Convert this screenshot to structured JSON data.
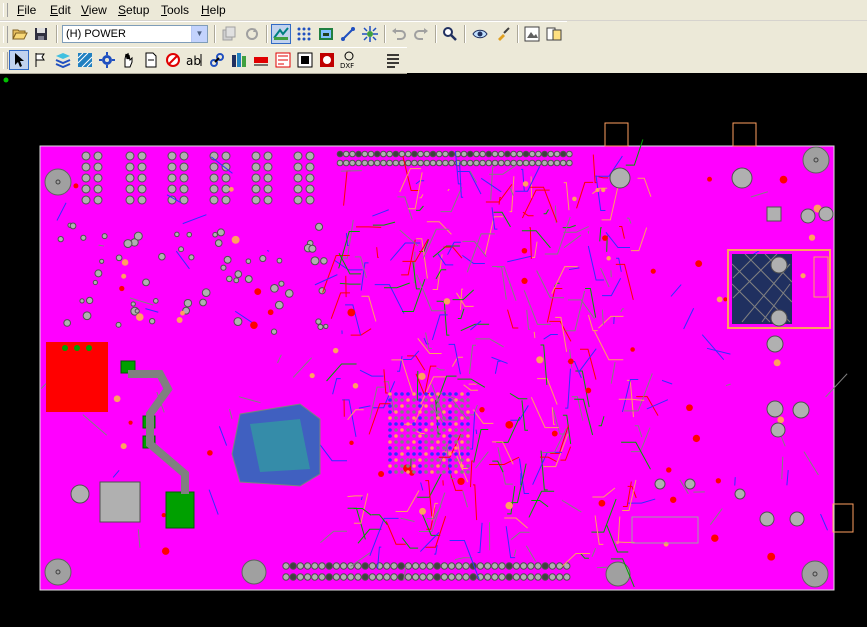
{
  "menubar": {
    "items": [
      {
        "accel": "F",
        "rest": "ile"
      },
      {
        "accel": "E",
        "rest": "dit"
      },
      {
        "accel": "V",
        "rest": "iew"
      },
      {
        "accel": "S",
        "rest": "etup"
      },
      {
        "accel": "T",
        "rest": "ools"
      },
      {
        "accel": "H",
        "rest": "elp"
      }
    ]
  },
  "toolbar": {
    "layer_value": "(H) POWER"
  },
  "icons": {
    "row1": [
      "open-folder-icon",
      "save-icon",
      "copy-icon",
      "refresh-icon",
      "route-icon",
      "grid-icon",
      "camera-icon",
      "add-route-icon",
      "via-icon",
      "undo-icon",
      "redo-icon",
      "zoom-icon",
      "view-icon",
      "paint-icon",
      "snapshot-icon",
      "compare-icon"
    ],
    "row2": [
      "select-arrow-icon",
      "flag-icon",
      "layer-stack-icon",
      "hatch-icon",
      "gear-icon",
      "hand-icon",
      "document-icon",
      "no-icon",
      "text-icon",
      "link-icon",
      "library-icon",
      "drc-icon",
      "report-icon",
      "package-icon",
      "drc-markers-icon",
      "dxf-icon",
      "list-icon"
    ]
  },
  "canvas": {
    "board_color": "#ff00ff",
    "background": "#000000",
    "copper_colors": [
      "#808080",
      "#3030ff",
      "#ff0000",
      "#00a000",
      "#ffa060"
    ]
  }
}
